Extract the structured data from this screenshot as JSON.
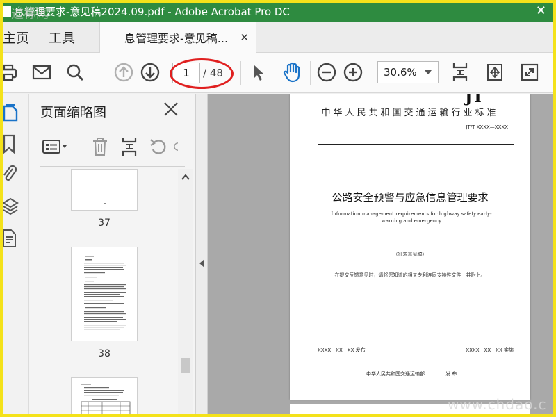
{
  "window": {
    "title": "息管理要求-意见稿2024.09.pdf - Adobe Acrobat Pro DC",
    "close_glyph": "✕"
  },
  "tabs": {
    "home": "主页",
    "tools": "工具",
    "document": "息管理要求-意见稿...",
    "document_close": "✕"
  },
  "toolbar": {
    "icons": [
      "print-icon",
      "email-icon",
      "search-icon",
      "page-up-icon",
      "page-down-icon",
      "select-cursor-icon",
      "hand-icon",
      "zoom-out-icon",
      "zoom-in-icon",
      "fit-page-icon",
      "scroll-mode-icon",
      "full-screen-icon"
    ],
    "page_current": "1",
    "page_total": "/ 48",
    "zoom": "30.6%"
  },
  "sidebar": {
    "panel_title": "页面缩略图",
    "panel_tools": [
      "options-menu-icon",
      "delete-icon",
      "insert-pages-icon",
      "rotate-left-icon",
      "rotate-right-icon"
    ],
    "thumbnails": [
      {
        "label": "37"
      },
      {
        "label": "38"
      }
    ]
  },
  "document_page": {
    "logo": "JT",
    "header": "中华人民共和国交通运输行业标准",
    "code": "JT/T XXXX—XXXX",
    "title": "公路安全预警与应急信息管理要求",
    "english_title": "Information management requirements for highway safety early-warning and emergency",
    "draft": "（征求意见稿）",
    "note": "在提交反馈意见时，请将您知道的相关专利连同支持性文件一并附上。",
    "release_date": "XXXX－XX－XX 发布",
    "implement_date": "XXXX－XX－XX 实施",
    "publisher": "中华人民共和国交通运输部",
    "publish_word": "发   布"
  },
  "watermarks": {
    "top_left": "道标网",
    "bottom_right": "www.chdao.c"
  },
  "colors": {
    "title_bar": "#2e8b40",
    "frame": "#f4e21a",
    "highlight_ellipse": "#e02020",
    "icon_blue": "#1a73c8"
  }
}
